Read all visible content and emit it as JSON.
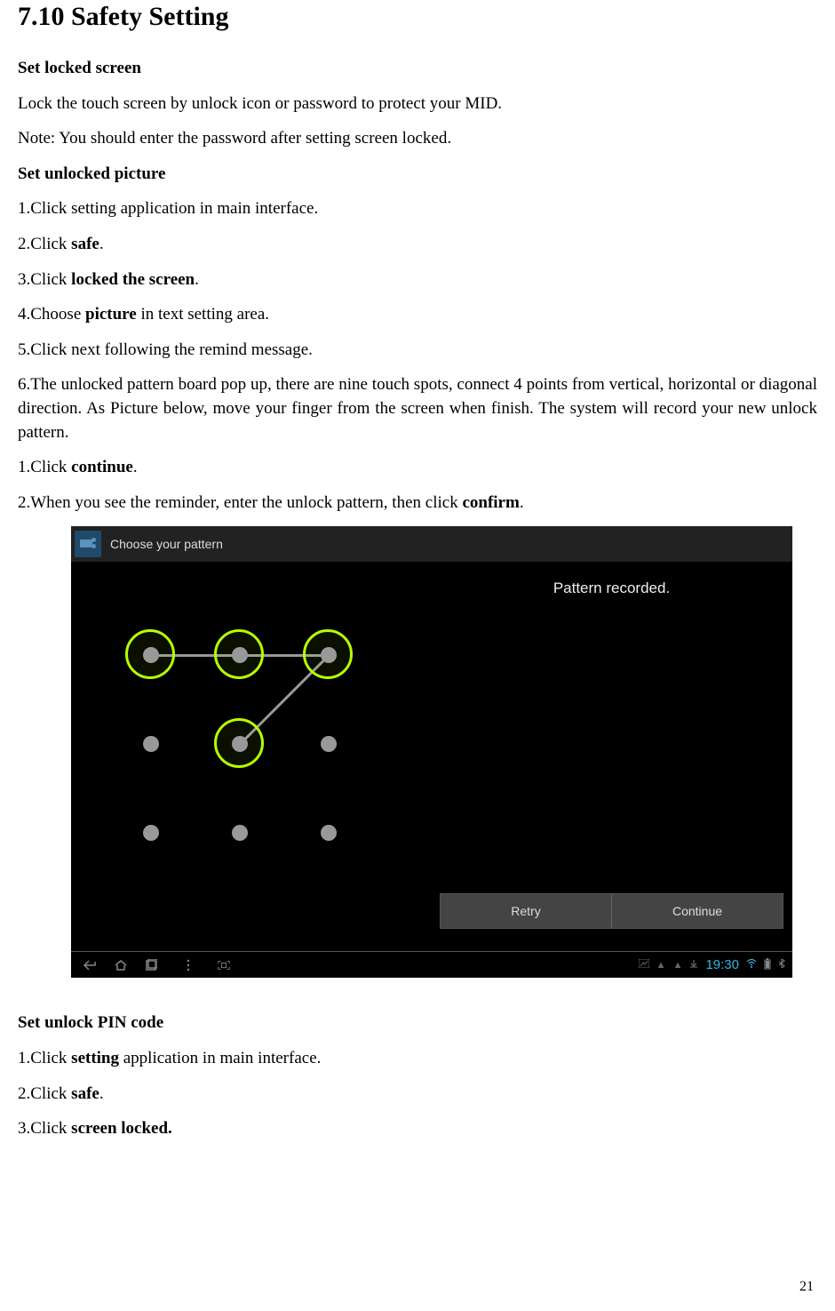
{
  "section": {
    "title": "7.10 Safety Setting"
  },
  "setLocked": {
    "heading": "Set locked screen",
    "p1": "Lock the touch screen by unlock icon or password to protect your MID.",
    "p2": "Note: You should enter the password after setting screen locked."
  },
  "setUnlockedPicture": {
    "heading": "Set unlocked picture",
    "s1": "1.Click setting application in main interface.",
    "s2_pre": "2.Click ",
    "s2_bold": "safe",
    "s2_post": ".",
    "s3_pre": "3.Click ",
    "s3_bold": "locked the screen",
    "s3_post": ".",
    "s4_pre": "4.Choose ",
    "s4_bold": "picture",
    "s4_post": " in text setting area.",
    "s5": "5.Click next following the remind message.",
    "s6": "6.The unlocked pattern board pop up, there are nine touch spots, connect 4 points from vertical, horizontal or diagonal direction. As Picture below, move your finger from the screen when finish. The system will record your new unlock pattern.",
    "c1_pre": "1.Click ",
    "c1_bold": "continue",
    "c1_post": ".",
    "c2_pre": "2.When you see the reminder, enter the unlock pattern, then click ",
    "c2_bold": "confirm",
    "c2_post": "."
  },
  "screenshot": {
    "headerTitle": "Choose your pattern",
    "recorded": "Pattern recorded.",
    "retry": "Retry",
    "continue": "Continue",
    "time": "19:30"
  },
  "setPin": {
    "heading": "Set unlock PIN code",
    "s1_pre": "1.Click ",
    "s1_bold": "setting",
    "s1_post": " application in main interface.",
    "s2_pre": "2.Click ",
    "s2_bold": "safe",
    "s2_post": ".",
    "s3_pre": "3.Click ",
    "s3_bold": "screen locked.",
    "s3_post": ""
  },
  "pageNumber": "21"
}
